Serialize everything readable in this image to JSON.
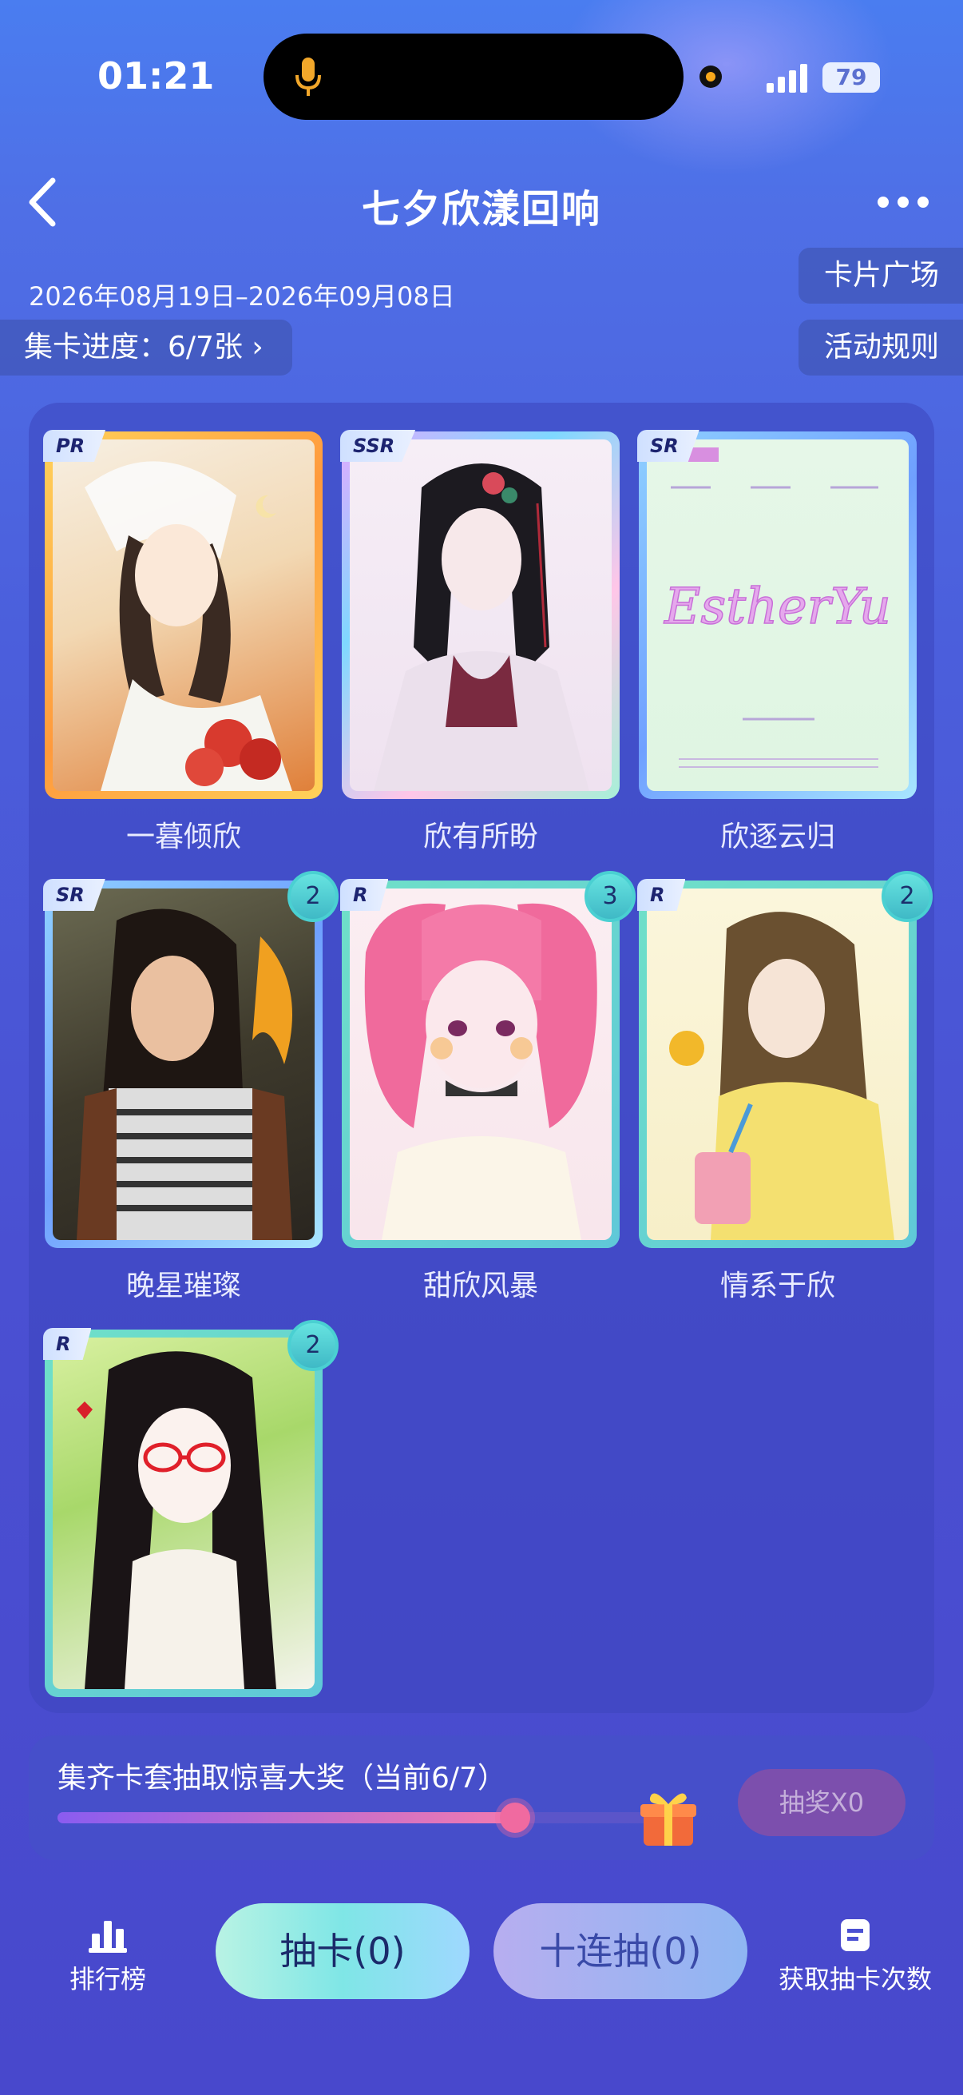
{
  "status_bar": {
    "time": "01:21",
    "battery": "79"
  },
  "header": {
    "title": "七夕欣漾回响"
  },
  "event": {
    "date_range": "2026年08月19日–2026年09月08日",
    "progress_label": "集卡进度：6/7张 ›",
    "card_square": "卡片广场",
    "rules": "活动规则"
  },
  "cards": [
    {
      "name": "一暮倾欣",
      "rarity": "PR",
      "count": ""
    },
    {
      "name": "欣有所盼",
      "rarity": "SSR",
      "count": ""
    },
    {
      "name": "欣逐云归",
      "rarity": "SR",
      "count": ""
    },
    {
      "name": "晚星璀璨",
      "rarity": "SR",
      "count": "2"
    },
    {
      "name": "甜欣风暴",
      "rarity": "R",
      "count": "3"
    },
    {
      "name": "情系于欣",
      "rarity": "R",
      "count": "2"
    },
    {
      "name": "",
      "rarity": "R",
      "count": "2"
    }
  ],
  "card3_art_text": "EstherYu",
  "reward": {
    "text": "集齐卡套抽取惊喜大奖（当前6/7）",
    "progress": 0.857,
    "draw_button": "抽奖X0"
  },
  "bottom_nav": {
    "leaderboard": "排行榜",
    "draw_one": "抽卡(0)",
    "draw_ten": "十连抽(0)",
    "get_chances": "获取抽卡次数"
  },
  "colors": {
    "accent_teal": "#7ee6e0",
    "pink": "#f06aa0",
    "background": "#4a50d2"
  }
}
